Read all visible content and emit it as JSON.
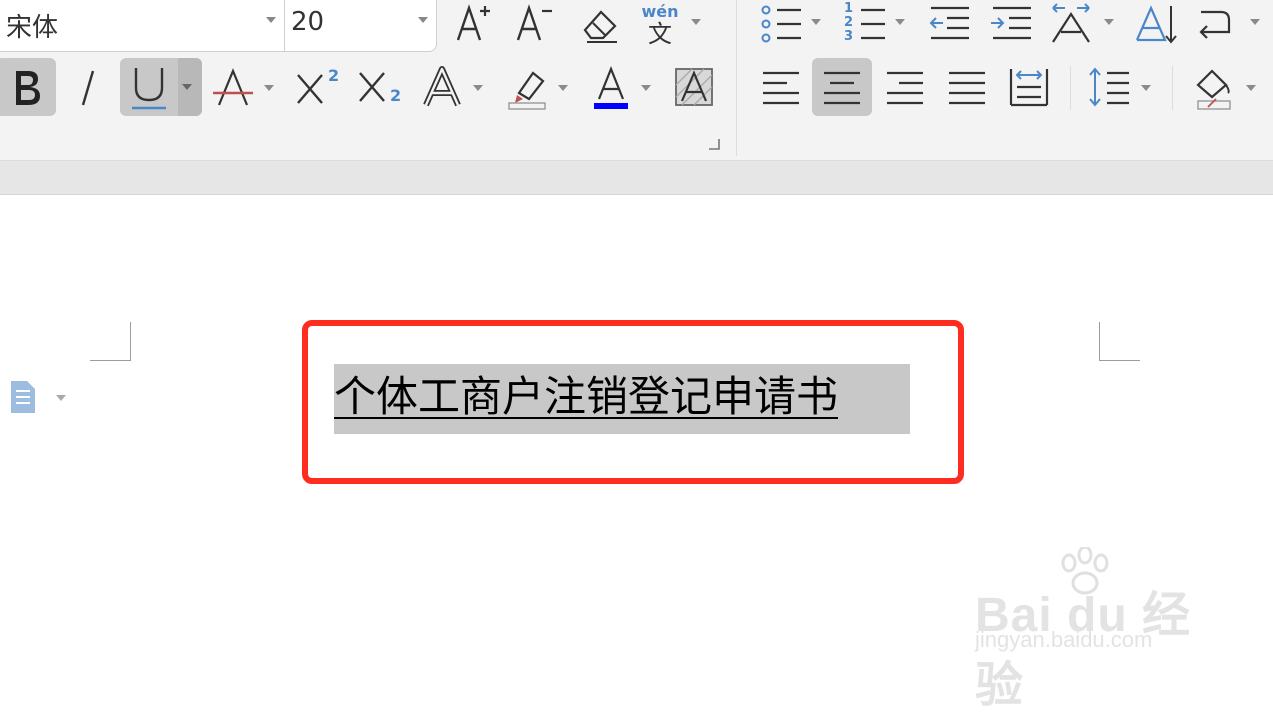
{
  "toolbar": {
    "font_name": "宋体",
    "font_size": "20",
    "phonetic_label": "wén",
    "phonetic_char": "文",
    "superscript_digit": "2",
    "subscript_digit": "2",
    "numbered_list_digits": "123",
    "font_color": "#0000ff",
    "accent_color": "#4a86c8"
  },
  "document": {
    "heading": "个体工商户注销登记申请书",
    "selection_color": "#c8c8c8",
    "highlight_box_color": "#ff2d20"
  },
  "watermark": {
    "logo": "Bai du 经验",
    "url": "jingyan.baidu.com"
  }
}
